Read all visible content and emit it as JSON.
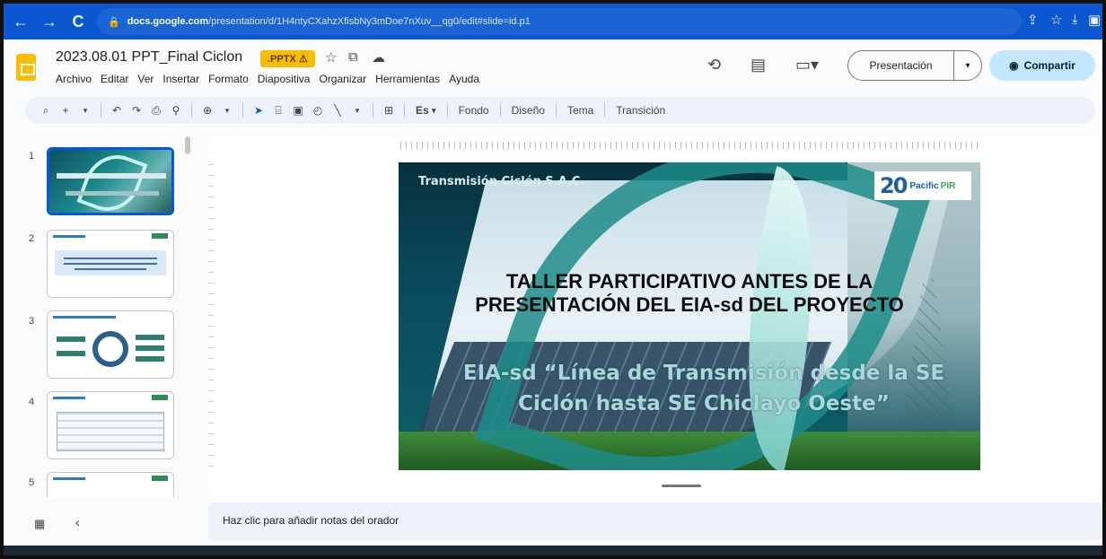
{
  "browser": {
    "url_host": "docs.google.com",
    "url_path": "/presentation/d/1H4ntyCXahzXfisbNy3mDoe7nXuv__qg0/edit#slide=id.p1"
  },
  "doc": {
    "title": "2023.08.01 PPT_Final Ciclon",
    "badge": ".PPTX"
  },
  "menu": [
    "Archivo",
    "Editar",
    "Ver",
    "Insertar",
    "Formato",
    "Diapositiva",
    "Organizar",
    "Herramientas",
    "Ayuda"
  ],
  "header": {
    "present_label": "Presentación",
    "share_label": "Compartir"
  },
  "toolbar": {
    "lang_label": "Es",
    "background_label": "Fondo",
    "layout_label": "Diseño",
    "theme_label": "Tema",
    "transition_label": "Transición"
  },
  "filmstrip": {
    "numbers": [
      "1",
      "2",
      "3",
      "4",
      "5"
    ]
  },
  "slide": {
    "company": "Transmisión Ciclón S.A.C.",
    "logo_number": "20",
    "logo_text_1": "Pacific",
    "logo_text_2": "PIR",
    "heading_line1": "TALLER PARTICIPATIVO ANTES DE LA",
    "heading_line2": "PRESENTACIÓN DEL EIA-sd DEL PROYECTO",
    "subtitle_line1": "EIA-sd “Línea de Transmisión desde la SE",
    "subtitle_line2": "Ciclón hasta SE Chiclayo Oeste”"
  },
  "notes": {
    "placeholder": "Haz clic para añadir notas del orador"
  },
  "colors": {
    "browser_bar": "#0b57d0",
    "share_button": "#c2e7ff",
    "badge": "#fbbc04",
    "selected_thumb": "#0b57d0"
  }
}
